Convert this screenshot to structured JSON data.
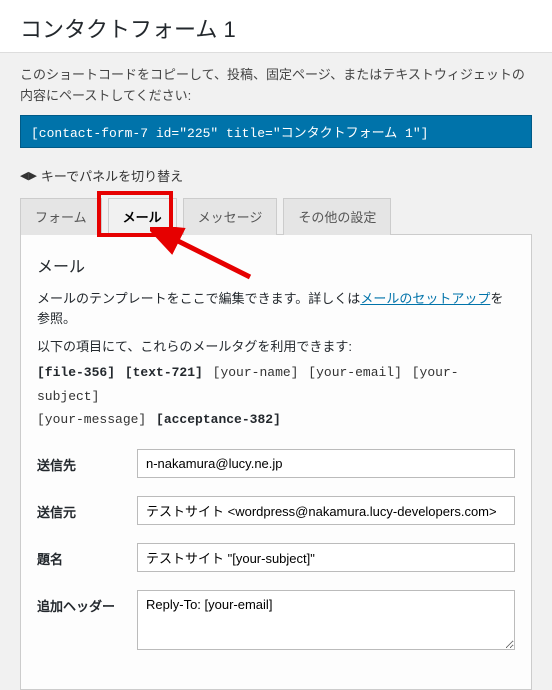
{
  "page": {
    "title": "コンタクトフォーム 1"
  },
  "shortcode": {
    "desc": "このショートコードをコピーして、投稿、固定ページ、またはテキストウィジェットの内容にペーストしてください:",
    "code": "[contact-form-7 id=\"225\" title=\"コンタクトフォーム 1\"]"
  },
  "panel_hint": "キーでパネルを切り替え",
  "tabs": {
    "form": "フォーム",
    "mail": "メール",
    "messages": "メッセージ",
    "other": "その他の設定"
  },
  "mail": {
    "heading": "メール",
    "desc_prefix": "メールのテンプレートをここで編集できます。詳しくは",
    "desc_link": "メールのセットアップ",
    "desc_suffix": "を参照。",
    "tag_intro": "以下の項目にて、これらのメールタグを利用できます:",
    "tags_bold1": "[file-356]",
    "tags_bold2": "[text-721]",
    "tags_n1": "[your-name]",
    "tags_n2": "[your-email]",
    "tags_n3": "[your-subject]",
    "tags_n4": "[your-message]",
    "tags_bold3": "[acceptance-382]"
  },
  "fields": {
    "to": {
      "label": "送信先",
      "value": "n-nakamura@lucy.ne.jp"
    },
    "from": {
      "label": "送信元",
      "value": "テストサイト <wordpress@nakamura.lucy-developers.com>"
    },
    "subject": {
      "label": "題名",
      "value": "テストサイト \"[your-subject]\""
    },
    "headers": {
      "label": "追加ヘッダー",
      "value": "Reply-To: [your-email]"
    }
  }
}
